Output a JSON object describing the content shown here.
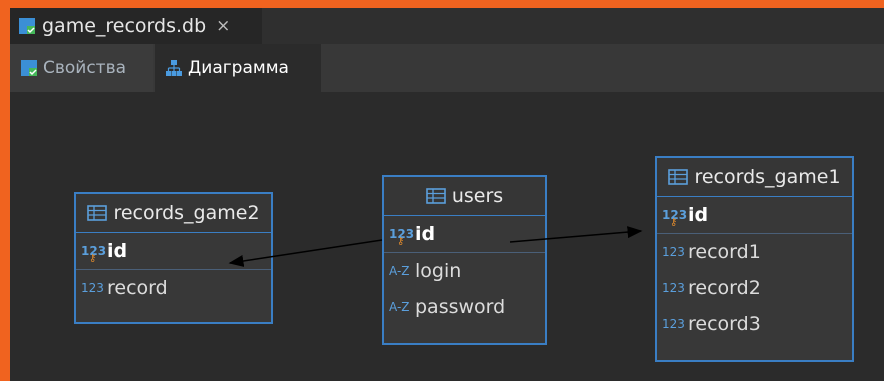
{
  "file_tab": {
    "title": "game_records.db",
    "close_glyph": "×"
  },
  "subtabs": [
    {
      "label": "Свойства"
    },
    {
      "label": "Диаграмма"
    }
  ],
  "entities": {
    "records_game2": {
      "name": "records_game2",
      "columns": [
        {
          "type": "123",
          "name": "id"
        },
        {
          "type": "123",
          "name": "record"
        }
      ]
    },
    "users": {
      "name": "users",
      "columns": [
        {
          "type": "123",
          "name": "id"
        },
        {
          "type": "A-Z",
          "name": "login"
        },
        {
          "type": "A-Z",
          "name": "password"
        }
      ]
    },
    "records_game1": {
      "name": "records_game1",
      "columns": [
        {
          "type": "123",
          "name": "id"
        },
        {
          "type": "123",
          "name": "record1"
        },
        {
          "type": "123",
          "name": "record2"
        },
        {
          "type": "123",
          "name": "record3"
        }
      ]
    }
  },
  "colors": {
    "frame": "#f0631f",
    "entity_border": "#3a7ec4",
    "type_icon": "#5b9fdc",
    "key_icon": "#e08a2c"
  }
}
